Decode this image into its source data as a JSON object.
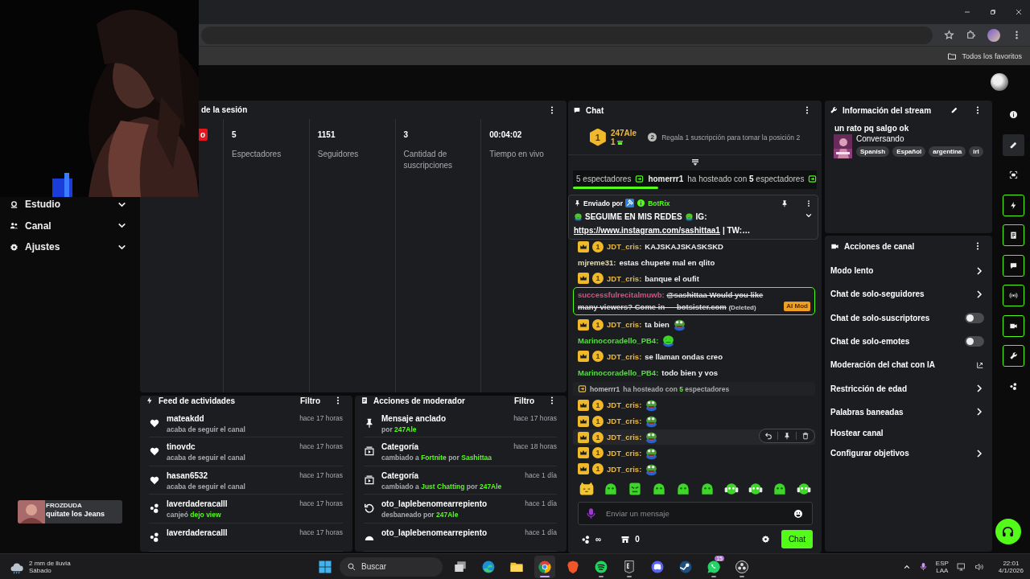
{
  "browser": {
    "bookmark": "Todos los favoritos"
  },
  "alert": {
    "user": "FROZDUDA",
    "message": "quitate los Jeans"
  },
  "sidebar": {
    "items": [
      {
        "label": "Estudio",
        "kind": "studio",
        "expanded": false
      },
      {
        "label": "Canal",
        "kind": "people",
        "expanded": false
      },
      {
        "label": "Ajustes",
        "kind": "gear",
        "expanded": false
      }
    ]
  },
  "session": {
    "title": "de la sesión",
    "live_badge": "o",
    "stats": [
      {
        "value": "5",
        "label": "Espectadores"
      },
      {
        "value": "1151",
        "label": "Seguidores"
      },
      {
        "value": "3",
        "label": "Cantidad de suscripciones"
      },
      {
        "value": "00:04:02",
        "label": "Tiempo en vivo"
      }
    ]
  },
  "activity_feed": {
    "title": "Feed de actividades",
    "filter": "Filtro",
    "items": [
      {
        "kind": "heart",
        "name": "mateakdd",
        "time": "hace 17 horas",
        "detail": [
          {
            "text": "acaba de seguir el canal",
            "highlight": false
          }
        ]
      },
      {
        "kind": "heart",
        "name": "tinovdc",
        "time": "hace 17 horas",
        "detail": [
          {
            "text": "acaba de seguir el canal",
            "highlight": false
          }
        ]
      },
      {
        "kind": "heart",
        "name": "hasan6532",
        "time": "hace 17 horas",
        "detail": [
          {
            "text": "acaba de seguir el canal",
            "highlight": false
          }
        ]
      },
      {
        "kind": "coins",
        "name": "laverdaderacalll",
        "time": "hace 17 horas",
        "detail": [
          {
            "text": "canjeó",
            "highlight": false
          },
          {
            "text": "dejo view",
            "highlight": true
          }
        ]
      },
      {
        "kind": "coins",
        "name": "laverdaderacalll",
        "time": "hace 17 horas"
      }
    ]
  },
  "mod_actions": {
    "title": "Acciones de moderador",
    "filter": "Filtro",
    "items": [
      {
        "kind": "pin",
        "name": "Mensaje anclado",
        "time": "hace 17 horas",
        "detail": [
          {
            "text": "por",
            "highlight": false
          },
          {
            "text": "247Ale",
            "highlight": true
          }
        ]
      },
      {
        "kind": "category",
        "name": "Categoría",
        "time": "hace 18 horas",
        "detail": [
          {
            "text": "cambiado a",
            "highlight": false
          },
          {
            "text": "Fortnite",
            "highlight": true
          },
          {
            "text": "por",
            "highlight": false
          },
          {
            "text": "Sashittaa",
            "highlight": true
          }
        ]
      },
      {
        "kind": "category",
        "name": "Categoría",
        "time": "hace 1 día",
        "detail": [
          {
            "text": "cambiado a",
            "highlight": false
          },
          {
            "text": "Just Chatting",
            "highlight": true
          },
          {
            "text": "por",
            "highlight": false
          },
          {
            "text": "247Ale",
            "highlight": true
          }
        ]
      },
      {
        "kind": "unban",
        "name": "oto_laplebenomearrepiento",
        "time": "hace 1 día",
        "detail": [
          {
            "text": "desbaneado por",
            "highlight": false
          },
          {
            "text": "247Ale",
            "highlight": true
          }
        ]
      },
      {
        "kind": "gauge",
        "name": "oto_laplebenomearrepiento",
        "time": "hace 1 día"
      }
    ]
  },
  "chat": {
    "title": "Chat",
    "top_gifter": {
      "rank": "1",
      "name": "247Ale",
      "count": "1",
      "goal_rank": "2",
      "goal": "Regala 1 suscripción para tomar la posición 2"
    },
    "host_banner": {
      "lead": "5 espectadores",
      "user": "homerrr1",
      "text": "ha hosteado con **5** espectadores",
      "level": 0.35
    },
    "pinned": {
      "label": "Enviado por",
      "author": "BotRix",
      "text": "SEGUIME EN MIS REDES",
      "after": "IG:",
      "link": "https://www.instagram.com/sashittaa1",
      "tail": "| TW:…"
    },
    "messages": [
      {
        "kind": "chat",
        "badges": [
          {
            "kind": "crown"
          },
          {
            "kind": "tier",
            "label": "1"
          }
        ],
        "user": "JDT_cris:",
        "color": "#e9b949",
        "text": "KAJSKAJSKASKSKD",
        "hovered": false
      },
      {
        "kind": "chat",
        "user": "mjreme31:",
        "color": "#e8dca8",
        "text": "estas chupete mal en qlito",
        "hovered": false
      },
      {
        "kind": "chat",
        "badges": [
          {
            "kind": "crown"
          },
          {
            "kind": "tier",
            "label": "1"
          }
        ],
        "user": "JDT_cris:",
        "color": "#e9b949",
        "text": "banque el oufit",
        "hovered": false
      },
      {
        "kind": "deleted",
        "user": "successfulrecitalmuwb:",
        "color": "#d9507f",
        "text": "@sashittaa Would you like many viewers? Come in — botsister.com",
        "note": "(Deleted)",
        "tag": "AI Mod"
      },
      {
        "kind": "chat",
        "badges": [
          {
            "kind": "crown"
          },
          {
            "kind": "tier",
            "label": "1"
          }
        ],
        "user": "JDT_cris:",
        "color": "#e9b949",
        "text": "ta bien",
        "emote": {
          "kind": "frog"
        },
        "hovered": false
      },
      {
        "kind": "chat",
        "user": "Marinocoradello_PB4:",
        "color": "#5bd94a",
        "emote": {
          "kind": "heartfrog"
        },
        "hovered": false
      },
      {
        "kind": "chat",
        "badges": [
          {
            "kind": "crown"
          },
          {
            "kind": "tier",
            "label": "1"
          }
        ],
        "user": "JDT_cris:",
        "color": "#e9b949",
        "text": "se llaman ondas creo",
        "hovered": false
      },
      {
        "kind": "chat",
        "user": "Marinocoradello_PB4:",
        "color": "#5bd94a",
        "text": "todo bien y vos",
        "hovered": false
      },
      {
        "kind": "host",
        "user": "homerrr1",
        "text": "ha hosteado con **5** espectadores"
      },
      {
        "kind": "chat",
        "badges": [
          {
            "kind": "crown"
          },
          {
            "kind": "tier",
            "label": "1"
          }
        ],
        "user": "JDT_cris:",
        "color": "#e9b949",
        "emote": {
          "kind": "frog"
        },
        "hovered": false
      },
      {
        "kind": "chat",
        "badges": [
          {
            "kind": "crown"
          },
          {
            "kind": "tier",
            "label": "1"
          }
        ],
        "user": "JDT_cris:",
        "color": "#e9b949",
        "emote": {
          "kind": "frog"
        },
        "hovered": false
      },
      {
        "kind": "chat",
        "badges": [
          {
            "kind": "crown"
          },
          {
            "kind": "tier",
            "label": "1"
          }
        ],
        "user": "JDT_cris:",
        "color": "#e9b949",
        "emote": {
          "kind": "frog"
        },
        "hovered": true
      },
      {
        "kind": "chat",
        "badges": [
          {
            "kind": "crown"
          },
          {
            "kind": "tier",
            "label": "1"
          }
        ],
        "user": "JDT_cris:",
        "color": "#e9b949",
        "emote": {
          "kind": "frog"
        },
        "hovered": false
      },
      {
        "kind": "chat",
        "badges": [
          {
            "kind": "crown"
          },
          {
            "kind": "tier",
            "label": "1"
          }
        ],
        "user": "JDT_cris:",
        "color": "#e9b949",
        "emote": {
          "kind": "frog"
        },
        "hovered": false
      }
    ],
    "emote_bar": [
      {
        "kind": "cat"
      },
      {
        "kind": "blob"
      },
      {
        "kind": "angry"
      },
      {
        "kind": "blob"
      },
      {
        "kind": "blob"
      },
      {
        "kind": "blob"
      },
      {
        "kind": "headphones"
      },
      {
        "kind": "headphones"
      },
      {
        "kind": "blob"
      },
      {
        "kind": "headphones"
      }
    ],
    "input": {
      "placeholder": "Enviar un mensaje"
    },
    "points": "∞",
    "store_count": "0",
    "send": "Chat"
  },
  "stream_info": {
    "title": "Información del stream",
    "stream_title": "un rato pq salgo ok",
    "category": "Conversando",
    "tags": [
      "Spanish",
      "Español",
      "argentina",
      "irl"
    ]
  },
  "channel_actions": {
    "title": "Acciones de canal",
    "items": [
      {
        "kind": "link",
        "label": "Modo lento"
      },
      {
        "kind": "link",
        "label": "Chat de solo-seguidores"
      },
      {
        "kind": "toggle",
        "label": "Chat de solo-suscriptores",
        "on": false
      },
      {
        "kind": "toggle",
        "label": "Chat de solo-emotes",
        "on": false
      },
      {
        "kind": "external",
        "label": "Moderación del chat con IA"
      },
      {
        "kind": "link",
        "label": "Restricción de edad"
      },
      {
        "kind": "link",
        "label": "Palabras baneadas"
      },
      {
        "kind": "plain",
        "label": "Hostear canal"
      },
      {
        "kind": "link",
        "label": "Configurar objetivos"
      }
    ]
  },
  "rail": {
    "items": [
      {
        "kind": "info",
        "selected": false,
        "on": false
      },
      {
        "kind": "pencil",
        "selected": true,
        "on": false
      },
      {
        "kind": "capture",
        "selected": false,
        "on": false
      },
      {
        "kind": "bolt",
        "selected": false,
        "on": true
      },
      {
        "kind": "doc",
        "selected": false,
        "on": true
      },
      {
        "kind": "chat",
        "selected": false,
        "on": true
      },
      {
        "kind": "broadcast",
        "selected": false,
        "on": true
      },
      {
        "kind": "camera",
        "selected": false,
        "on": true
      },
      {
        "kind": "wrench",
        "selected": false,
        "on": true
      },
      {
        "kind": "coins",
        "selected": false,
        "on": false
      }
    ]
  },
  "taskbar": {
    "weather": "2 mm de lluvia",
    "day": "Sábado",
    "search": {
      "placeholder": "Buscar"
    },
    "apps": [
      {
        "kind": "taskview",
        "running": false,
        "active": false
      },
      {
        "kind": "edge",
        "running": false,
        "active": false
      },
      {
        "kind": "files",
        "running": false,
        "active": false
      },
      {
        "kind": "chrome",
        "running": true,
        "active": true
      },
      {
        "kind": "brave",
        "running": false,
        "active": false
      },
      {
        "kind": "spotify",
        "running": true,
        "active": false
      },
      {
        "kind": "epic",
        "running": true,
        "active": false
      },
      {
        "kind": "discord",
        "running": false,
        "active": false
      },
      {
        "kind": "steam",
        "running": false,
        "active": false
      },
      {
        "kind": "whatsapp",
        "running": true,
        "active": false,
        "badge": "15"
      },
      {
        "kind": "obs",
        "running": true,
        "active": false
      }
    ],
    "lang": "ESP",
    "layout": "LAA",
    "time": "22:01",
    "date": "4/1/2026"
  }
}
